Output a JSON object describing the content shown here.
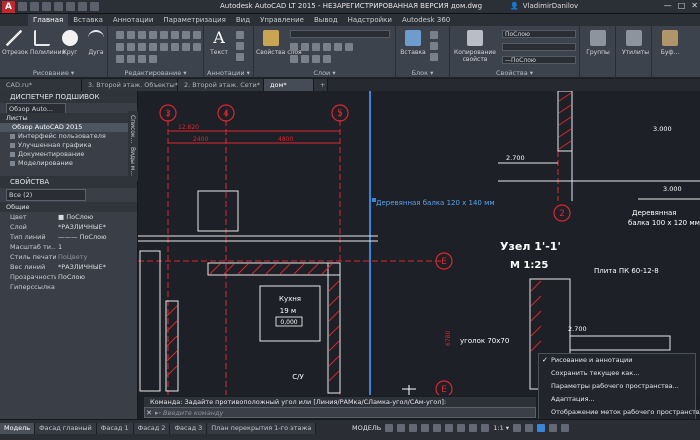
{
  "titlebar": {
    "logo": "A",
    "title": "Autodesk AutoCAD LT 2015 - НЕЗАРЕГИСТРИРОВАННАЯ ВЕРСИЯ    дом.dwg",
    "user": "VladimirDanilov",
    "window_controls": [
      "—",
      "□",
      "✕"
    ]
  },
  "ribbon_tabs": [
    "Главная",
    "Вставка",
    "Аннотации",
    "Параметризация",
    "Вид",
    "Управление",
    "Вывод",
    "Надстройки",
    "Autodesk 360"
  ],
  "ribbon": {
    "draw": {
      "label": "Рисование ▾",
      "tools": [
        "Отрезок",
        "Полилиния",
        "Круг",
        "Дуга"
      ]
    },
    "modify": {
      "label": "Редактирование ▾"
    },
    "annotation": {
      "label": "Аннотации ▾",
      "text_tool": "Текст"
    },
    "layers": {
      "label": "Слои ▾",
      "layer_props": "Свойства слоя"
    },
    "block": {
      "label": "Блок ▾",
      "insert": "Вставка"
    },
    "properties": {
      "label": "Свойства ▾",
      "copy_props": "Копирование свойств",
      "color_value": "ПоСлою",
      "linetype_value": "—ПоСлою"
    },
    "groups": "Группы",
    "utilities": "Утилиты",
    "clipboard": "Буф..."
  },
  "doc_tabs": [
    "CAD.ru*",
    "3. Второй этаж. Объекты*",
    "2. Второй этаж. Сети*",
    "дом*"
  ],
  "sheet_set": {
    "title": "ДИСПЕТЧЕР ПОДШИВОК",
    "dropdown": "Обзор Auto...",
    "sheets_label": "Листы",
    "root": "Обзор AutoCAD 2015",
    "items": [
      "Интерфейс пользователя",
      "Улучшенная графика",
      "Документирование",
      "Моделирование"
    ],
    "side_tabs": [
      "Список...",
      "Виды м..."
    ]
  },
  "properties_panel": {
    "title": "СВОЙСТВА",
    "selection": "Все (2)",
    "section": "Общие",
    "rows": [
      {
        "key": "Цвет",
        "value": "■ ПоСлою"
      },
      {
        "key": "Слой",
        "value": "*РАЗЛИЧНЫЕ*"
      },
      {
        "key": "Тип линий",
        "value": "——— ПоСлою"
      },
      {
        "key": "Масштаб ти...",
        "value": "1"
      },
      {
        "key": "Стиль печати",
        "value": "ПоЦвету"
      },
      {
        "key": "Вес линий",
        "value": "*РАЗЛИЧНЫЕ*"
      },
      {
        "key": "Прозрачность",
        "value": "ПоСлою"
      },
      {
        "key": "Гиперссылка",
        "value": ""
      }
    ]
  },
  "drawing": {
    "axis_labels": [
      "3",
      "4",
      "5",
      "2",
      "E",
      "E"
    ],
    "dims": [
      "3.000",
      "2.700",
      "3.000",
      "6780",
      "2.700",
      "4800",
      "2400",
      "12.820"
    ],
    "beam_label_1": "Деревянная балка 120 х 140 мм",
    "beam_label_2a": "Деревянная",
    "beam_label_2b": "балка 100 х 120 мм",
    "section_title": "Узел 1'-1'",
    "section_scale": "М 1:25",
    "slab_label": "Плита ПК 60-12-8",
    "angle_label": "уголок 70х70",
    "room_name": "Кухня",
    "room_area": "19 м",
    "room_value": "0,000",
    "room_other": "С/У"
  },
  "context_menu": [
    {
      "label": "Рисование и аннотации",
      "checked": true
    },
    {
      "label": "Сохранить текущее как...",
      "checked": false
    },
    {
      "label": "Параметры рабочего пространства...",
      "checked": false
    },
    {
      "label": "Адаптация...",
      "checked": false
    },
    {
      "label": "Отображение меток рабочего пространства",
      "checked": false
    }
  ],
  "command": {
    "history": "Команда: Задайте противоположный угол или [Линия/РАМка/СЛамка-угол/САм-угол]:",
    "prefix": "▸-",
    "placeholder": "Введите команду"
  },
  "layout_tabs": [
    "Модель",
    "Фасад главный",
    "Фасад 1",
    "Фасад 2",
    "Фасад 3",
    "План перекрытия 1-го этажа"
  ],
  "status": {
    "model": "МОДЕЛЬ",
    "scale": "1:1 ▾"
  },
  "colors": {
    "accent_red": "#d9272f",
    "canvas": "#1d2027",
    "highlight_blue": "#3a86d6"
  }
}
